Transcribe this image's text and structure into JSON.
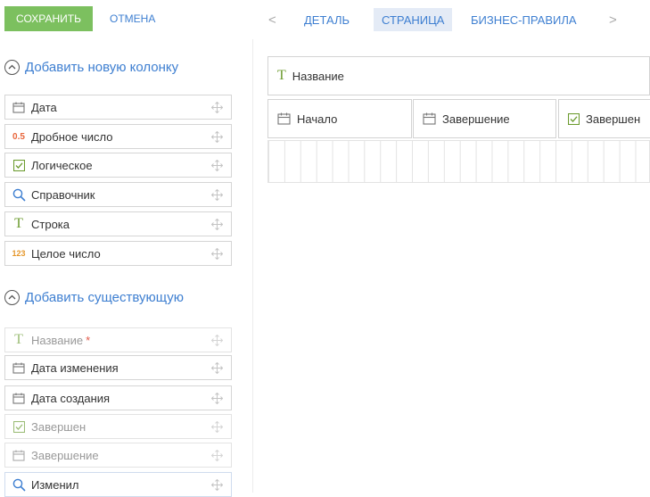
{
  "toolbar": {
    "save_label": "СОХРАНИТЬ",
    "cancel_label": "ОТМЕНА"
  },
  "tabs": [
    {
      "label": "ДЕТАЛЬ",
      "active": false
    },
    {
      "label": "СТРАНИЦА",
      "active": true
    },
    {
      "label": "БИЗНЕС-ПРАВИЛА",
      "active": false
    }
  ],
  "tab_nav": {
    "prev": "<",
    "next": ">"
  },
  "add_new": {
    "title": "Добавить новую колонку",
    "items": [
      {
        "label": "Дата",
        "icon": "calendar-icon"
      },
      {
        "label": "Дробное число",
        "icon": "decimal-icon",
        "icon_text": "0.5"
      },
      {
        "label": "Логическое",
        "icon": "checkbox-icon"
      },
      {
        "label": "Справочник",
        "icon": "search-icon"
      },
      {
        "label": "Строка",
        "icon": "text-icon",
        "icon_text": "T"
      },
      {
        "label": "Целое число",
        "icon": "integer-icon",
        "icon_text": "123"
      }
    ]
  },
  "add_existing": {
    "title": "Добавить существующую",
    "items": [
      {
        "label": "Название",
        "icon": "text-icon",
        "icon_text": "T",
        "required_mark": "*",
        "dimmed": true
      },
      {
        "label": "Дата изменения",
        "icon": "calendar-icon",
        "dimmed": false
      },
      {
        "label": "Дата создания",
        "icon": "calendar-icon",
        "dimmed": false
      },
      {
        "label": "Завершен",
        "icon": "checkbox-icon",
        "dimmed": true
      },
      {
        "label": "Завершение",
        "icon": "calendar-icon",
        "dimmed": true
      },
      {
        "label": "Изменил",
        "icon": "search-icon",
        "dimmed": false
      }
    ]
  },
  "canvas": {
    "title_field": {
      "label": "Название",
      "icon": "text-icon",
      "icon_text": "T"
    },
    "row_fields": [
      {
        "label": "Начало",
        "icon": "calendar-icon"
      },
      {
        "label": "Завершение",
        "icon": "calendar-icon"
      },
      {
        "label": "Завершен",
        "icon": "checkbox-icon"
      }
    ]
  },
  "colors": {
    "accent": "#3e7fd1",
    "save_button": "#7cc05f",
    "active_tab_bg": "#e4ebf6",
    "border": "#d5d5d5",
    "text_type_icon": "#6b9b2e",
    "decimal_icon": "#e8663c",
    "integer_icon": "#e5972b"
  }
}
